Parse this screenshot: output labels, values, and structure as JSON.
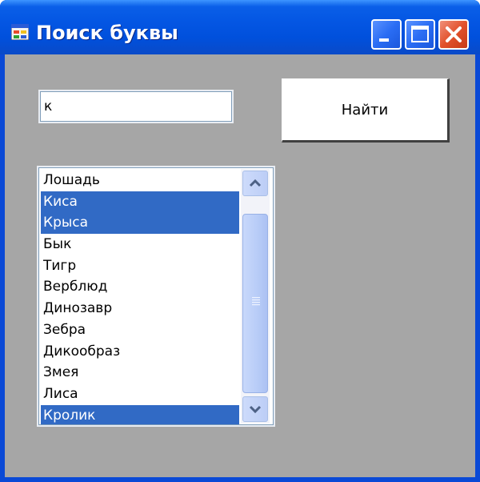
{
  "window": {
    "title": "Поиск буквы",
    "icon": "app-window-icon"
  },
  "title_buttons": {
    "minimize_icon": "minimize-icon",
    "maximize_icon": "maximize-icon",
    "close_icon": "close-icon"
  },
  "search": {
    "value": "к"
  },
  "find_button": {
    "label": "Найти"
  },
  "list": {
    "items": [
      {
        "label": "Лошадь",
        "selected": false
      },
      {
        "label": "Киса",
        "selected": true
      },
      {
        "label": "Крыса",
        "selected": true
      },
      {
        "label": "Бык",
        "selected": false
      },
      {
        "label": "Тигр",
        "selected": false
      },
      {
        "label": "Верблюд",
        "selected": false
      },
      {
        "label": "Динозавр",
        "selected": false
      },
      {
        "label": "Зебра",
        "selected": false
      },
      {
        "label": "Дикообраз",
        "selected": false
      },
      {
        "label": "Змея",
        "selected": false
      },
      {
        "label": "Лиса",
        "selected": false
      },
      {
        "label": "Кролик",
        "selected": true
      }
    ]
  },
  "colors": {
    "titlebar": "#0456e3",
    "client_background": "#a6a6a6",
    "selection": "#316ac5",
    "selection_text": "#ffffff",
    "close_button": "#e2522c"
  }
}
